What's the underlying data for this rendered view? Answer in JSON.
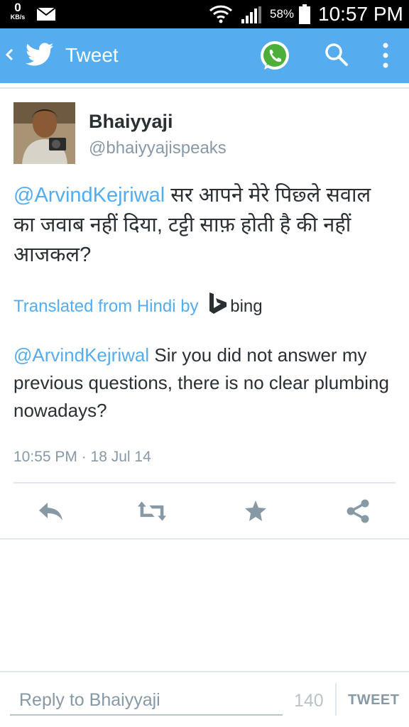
{
  "status_bar": {
    "net_speed": "0",
    "net_unit": "KB/s",
    "battery_percent": "58%",
    "time": "10:57 PM"
  },
  "app_bar": {
    "title": "Tweet",
    "accent_color": "#55acee"
  },
  "tweet": {
    "display_name": "Bhaiyyaji",
    "handle": "@bhaiyyajispeaks",
    "mention": "@ArvindKejriwal",
    "text_hindi": " सर आपने मेरे पिछ्ले सवाल  का जवाब नहीं दिया, टट्टी साफ़ होती है की नहीं आजकल?",
    "translated_label": "Translated from Hindi by",
    "translator": "bing",
    "translation_mention": "@ArvindKejriwal",
    "translation_text": " Sir you did not answer my previous questions, there is no clear plumbing nowadays?",
    "timestamp": "10:55 PM · 18 Jul 14"
  },
  "actions": {
    "icons": [
      "reply-icon",
      "retweet-icon",
      "favorite-icon",
      "share-icon"
    ]
  },
  "reply_bar": {
    "placeholder": "Reply to Bhaiyyaji",
    "char_count": "140",
    "tweet_button": "TWEET"
  }
}
